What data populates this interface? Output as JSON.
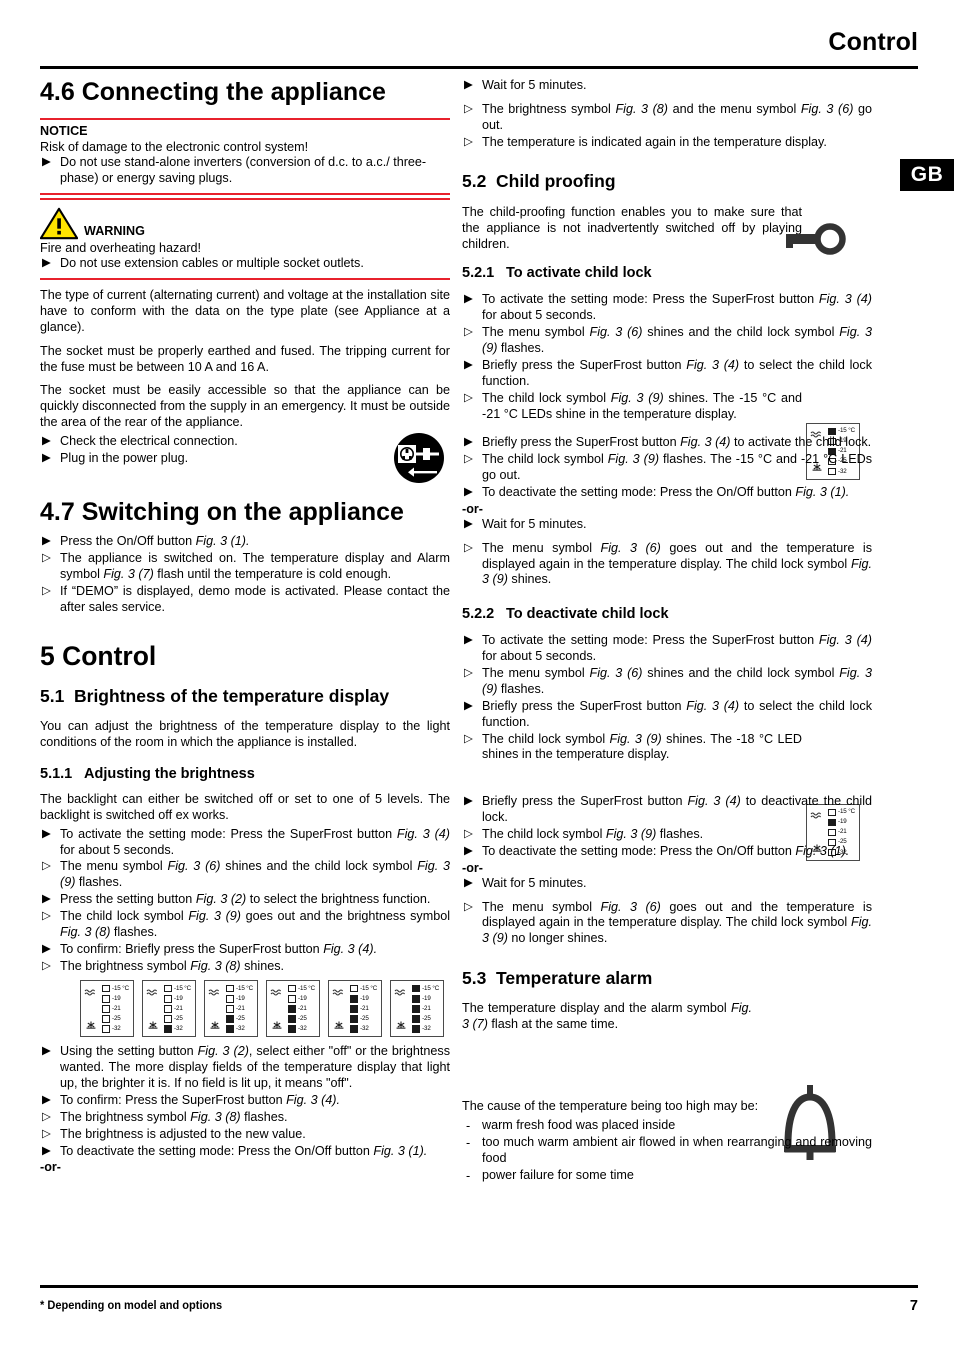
{
  "header": {
    "title": "Control",
    "lang_tab": "GB"
  },
  "footer": {
    "note": "* Depending on model and options",
    "page": "7"
  },
  "left": {
    "s46": {
      "heading": "4.6 Connecting the appliance",
      "notice": {
        "title": "NOTICE",
        "line": "Risk of damage to the electronic control system!",
        "item": "Do not use stand-alone inverters (conversion of d.c. to a.c./ three-phase) or energy saving plugs."
      },
      "warning": {
        "title": "WARNING",
        "line": "Fire and overheating hazard!",
        "item": "Do not use extension cables or multiple socket outlets."
      },
      "p1": "The type of current (alternating current) and voltage at the installation site have to conform with the data on the type plate (see Appliance at a glance).",
      "p2": "The socket must be properly earthed and fused. The tripping current for the fuse must be between 10 A and 16 A.",
      "p3": "The socket must be easily accessible so that the appliance can be quickly disconnected from the supply in an emergency. It must be outside the area of the rear of the appliance.",
      "steps": [
        {
          "kind": "act",
          "text": "Check the electrical connection."
        },
        {
          "kind": "act",
          "text": "Plug in the power plug."
        }
      ]
    },
    "s47": {
      "heading": "4.7 Switching on the appliance",
      "steps": [
        {
          "kind": "act",
          "text": "Press the On/Off button ",
          "fig": "Fig. 3 (1).",
          "after": ""
        },
        {
          "kind": "res",
          "text": "The appliance is switched on. The temperature display and Alarm symbol ",
          "fig": "Fig. 3 (7)",
          "after": " flash until the temperature is cold enough."
        },
        {
          "kind": "res",
          "text": "If “DEMO” is displayed, demo mode is activated. Please contact the after sales service.",
          "fig": "",
          "after": ""
        }
      ]
    },
    "s5": {
      "heading": "5 Control"
    },
    "s51": {
      "heading_num": "5.1",
      "heading": "Brightness of the temperature display",
      "intro": "You can adjust the brightness of the temperature display to the light conditions of the room in which the appliance is installed.",
      "sub_num": "5.1.1",
      "sub": "Adjusting the brightness",
      "p1": "The backlight can either be switched off or set to one of 5 levels. The backlight is switched off ex works.",
      "steps_a": [
        {
          "kind": "act",
          "text": "To activate the setting mode: Press the SuperFrost button ",
          "fig": "Fig. 3 (4)",
          "after": " for about 5 seconds."
        },
        {
          "kind": "res",
          "text": "The menu symbol ",
          "fig": "Fig. 3 (6)",
          "after": " shines and the child lock symbol ",
          "fig2": "Fig. 3 (9)",
          "after2": " flashes."
        },
        {
          "kind": "act",
          "text": "Press the setting button ",
          "fig": "Fig. 3 (2)",
          "after": " to select the brightness function."
        },
        {
          "kind": "res",
          "text": "The child lock symbol ",
          "fig": "Fig. 3 (9)",
          "after": " goes out and the brightness symbol ",
          "fig2": "Fig. 3 (8)",
          "after2": " flashes."
        },
        {
          "kind": "act",
          "text": "To confirm: Briefly press the SuperFrost button ",
          "fig": "Fig. 3 (4).",
          "after": ""
        },
        {
          "kind": "res",
          "text": "The brightness symbol ",
          "fig": "Fig. 3 (8)",
          "after": " shines."
        }
      ],
      "steps_b": [
        {
          "kind": "act",
          "text": "Using the setting button ",
          "fig": "Fig. 3 (2)",
          "after": ", select either \"off\" or the brightness wanted. The more display fields of the temperature display that light up, the brighter it is. If no field is lit up, it means \"off\"."
        },
        {
          "kind": "act",
          "text": "To confirm: Press the SuperFrost button ",
          "fig": "Fig. 3 (4).",
          "after": ""
        },
        {
          "kind": "res",
          "text": "The brightness symbol ",
          "fig": "Fig. 3 (8)",
          "after": " flashes."
        },
        {
          "kind": "res",
          "text": "The brightness is adjusted to the new value.",
          "fig": "",
          "after": ""
        },
        {
          "kind": "act",
          "text": "To deactivate the setting mode: Press the On/Off button ",
          "fig": "Fig. 3 (1).",
          "after": ""
        }
      ],
      "or_label": "-or-"
    }
  },
  "right": {
    "top_steps": [
      {
        "kind": "act",
        "text": "Wait for 5 minutes.",
        "fig": "",
        "after": ""
      }
    ],
    "top_steps2": [
      {
        "kind": "res",
        "text": "The brightness symbol ",
        "fig": "Fig. 3 (8)",
        "after": " and the menu symbol ",
        "fig2": "Fig. 3 (6)",
        "after2": " go out."
      },
      {
        "kind": "res",
        "text": "The temperature is indicated again in the temperature display.",
        "fig": "",
        "after": ""
      }
    ],
    "s52": {
      "heading_num": "5.2",
      "heading": "Child proofing",
      "intro": "The child-proofing function enables you to make sure that the appliance is not inadvertently switched off by playing children.",
      "sub1_num": "5.2.1",
      "sub1": "To activate child lock",
      "steps1a": [
        {
          "kind": "act",
          "text": "To activate the setting mode: Press the SuperFrost button ",
          "fig": "Fig. 3 (4)",
          "after": " for about 5 seconds."
        },
        {
          "kind": "res",
          "text": "The menu symbol ",
          "fig": "Fig. 3 (6)",
          "after": " shines and the child lock symbol ",
          "fig2": "Fig. 3 (9)",
          "after2": " flashes."
        },
        {
          "kind": "act",
          "text": "Briefly press the SuperFrost button ",
          "fig": "Fig. 3 (4)",
          "after": " to select the child lock function."
        },
        {
          "kind": "res",
          "text": "The child lock symbol ",
          "fig": "Fig. 3 (9)",
          "after": " shines. The -15 °C and -21 °C LEDs shine in the temperature display."
        }
      ],
      "steps1b": [
        {
          "kind": "act",
          "text": "Briefly press the SuperFrost button ",
          "fig": "Fig. 3 (4)",
          "after": " to activate the child lock."
        },
        {
          "kind": "res",
          "text": "The child lock symbol ",
          "fig": "Fig. 3 (9)",
          "after": " flashes. The -15 °C and -21 °C LEDs go out."
        },
        {
          "kind": "act",
          "text": "To deactivate the setting mode: Press the On/Off button ",
          "fig": "Fig. 3 (1).",
          "after": ""
        }
      ],
      "or_label": "-or-",
      "steps1c": [
        {
          "kind": "act",
          "text": "Wait for 5 minutes.",
          "fig": "",
          "after": ""
        }
      ],
      "steps1d": [
        {
          "kind": "res",
          "text": "The menu symbol ",
          "fig": "Fig. 3 (6)",
          "after": " goes out and the temperature is displayed again in the temperature display. The child lock symbol ",
          "fig2": "Fig. 3 (9)",
          "after2": " shines."
        }
      ],
      "sub2_num": "5.2.2",
      "sub2": "To deactivate child lock",
      "steps2a": [
        {
          "kind": "act",
          "text": "To activate the setting mode: Press the SuperFrost button ",
          "fig": "Fig. 3 (4)",
          "after": " for about 5 seconds."
        },
        {
          "kind": "res",
          "text": "The menu symbol ",
          "fig": "Fig. 3 (6)",
          "after": " shines and the child lock symbol ",
          "fig2": "Fig. 3 (9)",
          "after2": " flashes."
        },
        {
          "kind": "act",
          "text": "Briefly press the SuperFrost button ",
          "fig": "Fig. 3 (4)",
          "after": " to select the child lock function."
        },
        {
          "kind": "res",
          "text": "The child lock symbol ",
          "fig": "Fig. 3 (9)",
          "after": " shines. The -18 °C LED shines in the temperature display."
        }
      ],
      "steps2b": [
        {
          "kind": "act",
          "text": "Briefly press the SuperFrost button ",
          "fig": "Fig. 3 (4)",
          "after": " to deactivate the child lock."
        },
        {
          "kind": "res",
          "text": "The child lock symbol ",
          "fig": "Fig. 3 (9)",
          "after": " flashes."
        },
        {
          "kind": "act",
          "text": "To deactivate the setting mode: Press the On/Off button ",
          "fig": "Fig. 3 (1).",
          "after": ""
        }
      ],
      "or_label2": "-or-",
      "steps2c": [
        {
          "kind": "act",
          "text": "Wait for 5 minutes.",
          "fig": "",
          "after": ""
        }
      ],
      "steps2d": [
        {
          "kind": "res",
          "text": "The menu symbol ",
          "fig": "Fig. 3 (6)",
          "after": " goes out and the temperature is displayed again in the temperature display. The child lock symbol ",
          "fig2": "Fig. 3 (9)",
          "after2": " no longer shines."
        }
      ]
    },
    "s53": {
      "heading_num": "5.3",
      "heading": "Temperature alarm",
      "p1_a": "The temperature display and the alarm symbol ",
      "p1_fig": "Fig. 3 (7)",
      "p1_b": " flash at the same time.",
      "cause_intro": "The cause of the temperature being too high may be:",
      "causes": [
        "warm fresh food was placed inside",
        "too much warm ambient air flowed in when rearranging and removing food",
        "power failure for some time"
      ]
    }
  },
  "led_labels": [
    "-15 °C",
    "-19",
    "-21",
    "-25",
    "-32"
  ],
  "brightness_figure": {
    "panels": [
      {
        "on": [
          false,
          false,
          false,
          false,
          false
        ]
      },
      {
        "on": [
          false,
          false,
          false,
          false,
          true
        ]
      },
      {
        "on": [
          false,
          false,
          false,
          true,
          true
        ]
      },
      {
        "on": [
          false,
          false,
          true,
          true,
          true
        ]
      },
      {
        "on": [
          false,
          true,
          true,
          true,
          true
        ]
      },
      {
        "on": [
          true,
          true,
          true,
          true,
          true
        ]
      }
    ]
  },
  "childlock_figures": {
    "activate": {
      "on": [
        true,
        false,
        true,
        false,
        false
      ]
    },
    "deactivate": {
      "on": [
        false,
        true,
        false,
        false,
        false
      ]
    }
  },
  "colors": {
    "red_rule": "#e8212c",
    "warn_yellow": "#ffe400",
    "icon_dark": "#333333"
  }
}
